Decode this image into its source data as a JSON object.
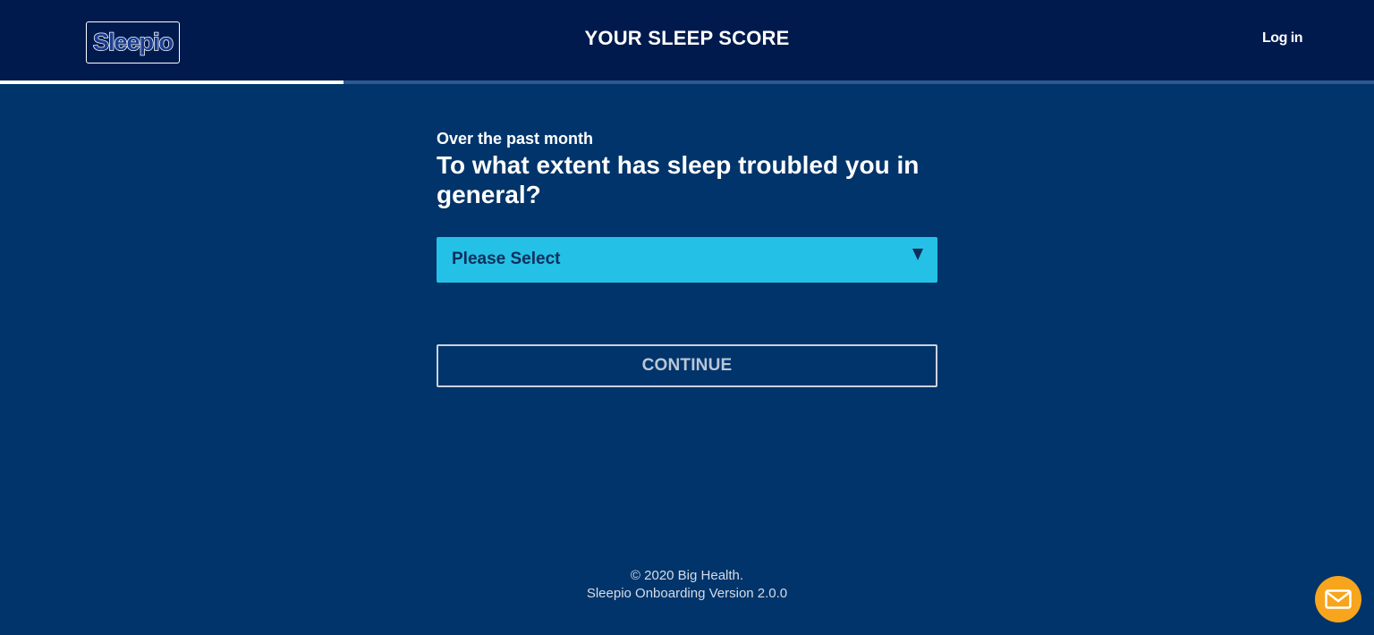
{
  "header": {
    "logo_text": "Sleepio",
    "title": "YOUR SLEEP SCORE",
    "login_label": "Log in"
  },
  "progress": {
    "fraction": 0.25
  },
  "question": {
    "subtitle": "Over the past month",
    "text": "To what extent has sleep troubled you in general?"
  },
  "select": {
    "selected_label": "Please Select"
  },
  "continue_label": "CONTINUE",
  "footer": {
    "copyright": "© 2020 Big Health.",
    "version": "Sleepio Onboarding Version 2.0.0"
  },
  "icons": {
    "chat": "mail-envelope-icon",
    "dropdown": "triangle-down-icon"
  },
  "colors": {
    "background": "#00346a",
    "header": "#001a4d",
    "select_fill": "#25c0e5",
    "chat_button": "#f7a51c"
  }
}
